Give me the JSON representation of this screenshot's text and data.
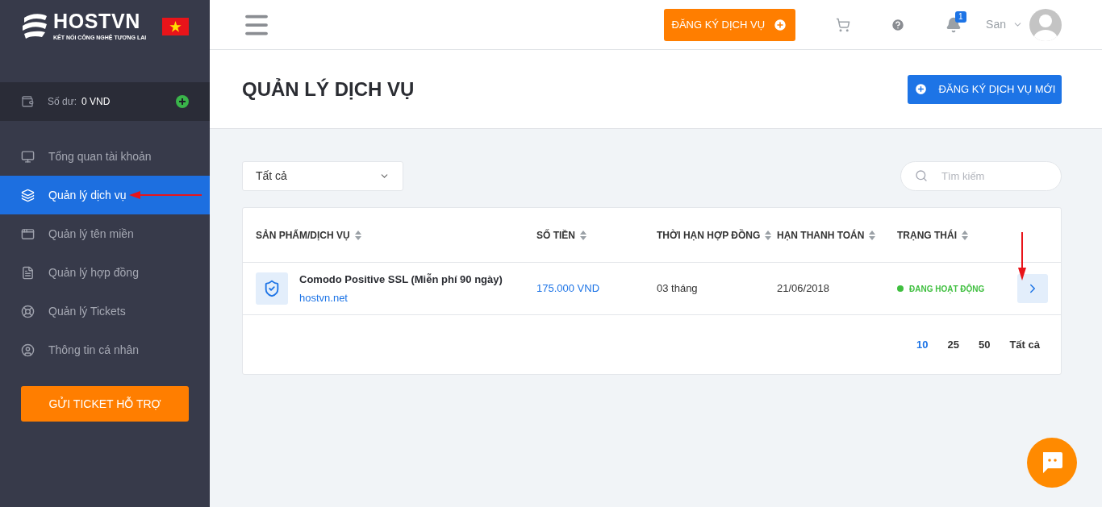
{
  "sidebar": {
    "logo": {
      "name": "HOSTVN",
      "tagline": "KẾT NỐI CÔNG NGHỆ TƯƠNG LAI"
    },
    "balance": {
      "label": "Số dư:",
      "value": "0 VND"
    },
    "items": [
      {
        "label": "Tổng quan tài khoản",
        "selected": false
      },
      {
        "label": "Quản lý dịch vụ",
        "selected": true
      },
      {
        "label": "Quản lý tên miền",
        "selected": false
      },
      {
        "label": "Quản lý hợp đồng",
        "selected": false
      },
      {
        "label": "Quản lý Tickets",
        "selected": false
      },
      {
        "label": "Thông tin cá nhân",
        "selected": false
      }
    ],
    "support_button": "GỬI TICKET HỖ TRỢ"
  },
  "topbar": {
    "register_button": "ĐĂNG KÝ DỊCH VỤ",
    "notification_count": "1",
    "user_name": "San"
  },
  "page": {
    "title": "QUẢN LÝ DỊCH VỤ",
    "new_button": "ĐĂNG KÝ DỊCH VỤ MỚI"
  },
  "filter": {
    "value": "Tất cả"
  },
  "search": {
    "placeholder": "Tìm kiếm"
  },
  "table": {
    "columns": [
      "SẢN PHẨM/DỊCH VỤ",
      "SỐ TIỀN",
      "THỜI HẠN HỢP ĐỒNG",
      "HẠN THANH TOÁN",
      "TRẠNG THÁI"
    ],
    "rows": [
      {
        "product": "Comodo Positive SSL (Miễn phí 90 ngày)",
        "domain": "hostvn.net",
        "amount": "175.000 VND",
        "term": "03 tháng",
        "due": "21/06/2018",
        "status": "ĐANG HOẠT ĐỘNG",
        "color": "#3fbf3f"
      }
    ]
  },
  "page_sizes": [
    {
      "label": "10",
      "selected": true
    },
    {
      "label": "25",
      "selected": false
    },
    {
      "label": "50",
      "selected": false
    },
    {
      "label": "Tất cả",
      "selected": false
    }
  ]
}
